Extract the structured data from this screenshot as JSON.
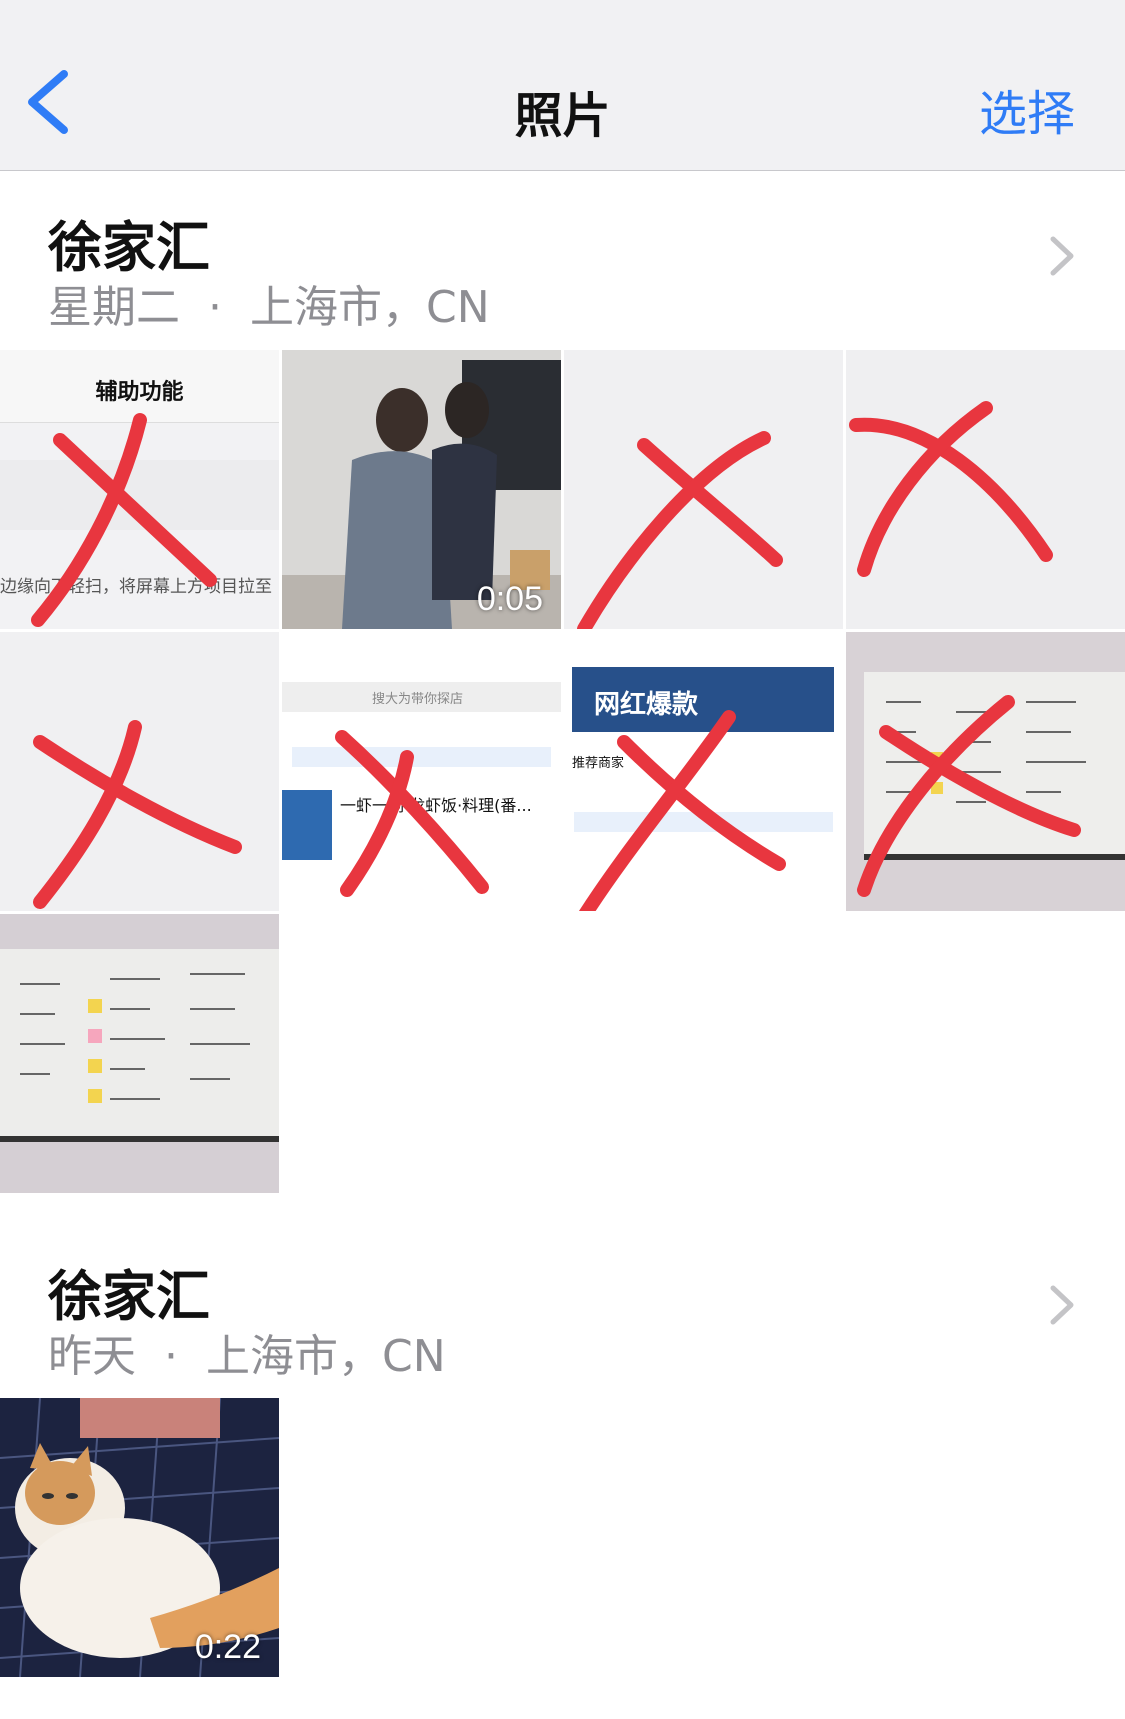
{
  "navbar": {
    "title": "照片",
    "select_label": "选择",
    "back_icon": "chevron-left-icon"
  },
  "sections": [
    {
      "location": "徐家汇",
      "date": "星期二",
      "place": "上海市，CN",
      "separator": "·",
      "tiles": [
        {
          "kind": "screenshot",
          "title": "辅助功能",
          "text": "边缘向下轻扫，将屏幕上方项目拉至",
          "crossed": true
        },
        {
          "kind": "video",
          "duration": "0:05",
          "crossed": false
        },
        {
          "kind": "blank",
          "crossed": true
        },
        {
          "kind": "blank",
          "crossed": true
        },
        {
          "kind": "blank",
          "crossed": true
        },
        {
          "kind": "screenshot",
          "title": "一虾一刻·龙虾饭·料理(番...",
          "text": "搜大为带你探店",
          "crossed": true
        },
        {
          "kind": "screenshot",
          "title": "网红爆款",
          "text": "推荐商家",
          "crossed": true
        },
        {
          "kind": "photo",
          "crossed": true
        },
        {
          "kind": "photo",
          "crossed": false
        }
      ]
    },
    {
      "location": "徐家汇",
      "date": "昨天",
      "place": "上海市，CN",
      "separator": "·",
      "tiles": [
        {
          "kind": "video",
          "duration": "0:22",
          "crossed": false
        }
      ]
    }
  ],
  "colors": {
    "accent": "#2f7cf6",
    "cross": "#e8363f",
    "subtitle": "#8e8e93"
  }
}
